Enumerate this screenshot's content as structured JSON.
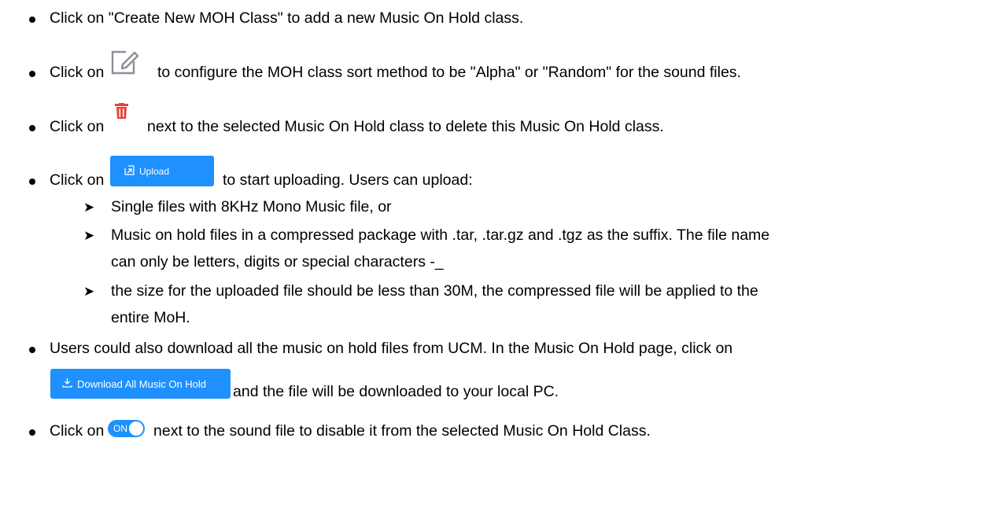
{
  "colors": {
    "accent": "#1e90ff",
    "delete": "#e8403a",
    "text": "#000000"
  },
  "bullets": [
    {
      "text": "Click on \"Create New MOH Class\" to add a new Music On Hold class."
    },
    {
      "prefix": "Click on",
      "icon": "edit-icon",
      "suffix": "to configure the MOH class sort method to be \"Alpha\" or \"Random\" for the sound files."
    },
    {
      "prefix": "Click on",
      "icon": "trash-icon",
      "suffix": "next to the selected Music On Hold class to delete this Music On Hold class."
    },
    {
      "prefix": "Click on",
      "button_label": "Upload",
      "suffix": "to start uploading. Users can upload:"
    },
    {
      "line1": "Users could also download all the music on hold files from UCM. In the Music On Hold page, click on",
      "button_label": "Download All Music On Hold",
      "suffix": "and the file will be downloaded to your local PC."
    },
    {
      "prefix": "Click on",
      "toggle_label": "ON",
      "suffix": "next to the sound file to disable it from the selected Music On Hold Class."
    }
  ],
  "sub_bullets": [
    {
      "lines": [
        "Single files with 8KHz Mono Music file, or"
      ]
    },
    {
      "lines": [
        "Music on hold files in a compressed package with .tar, .tar.gz and .tgz as the suffix. The file name",
        "can only be letters, digits or special characters -_"
      ]
    },
    {
      "lines": [
        "the size for the uploaded file should be less than 30M, the compressed file will be applied to the",
        "entire MoH."
      ]
    }
  ]
}
